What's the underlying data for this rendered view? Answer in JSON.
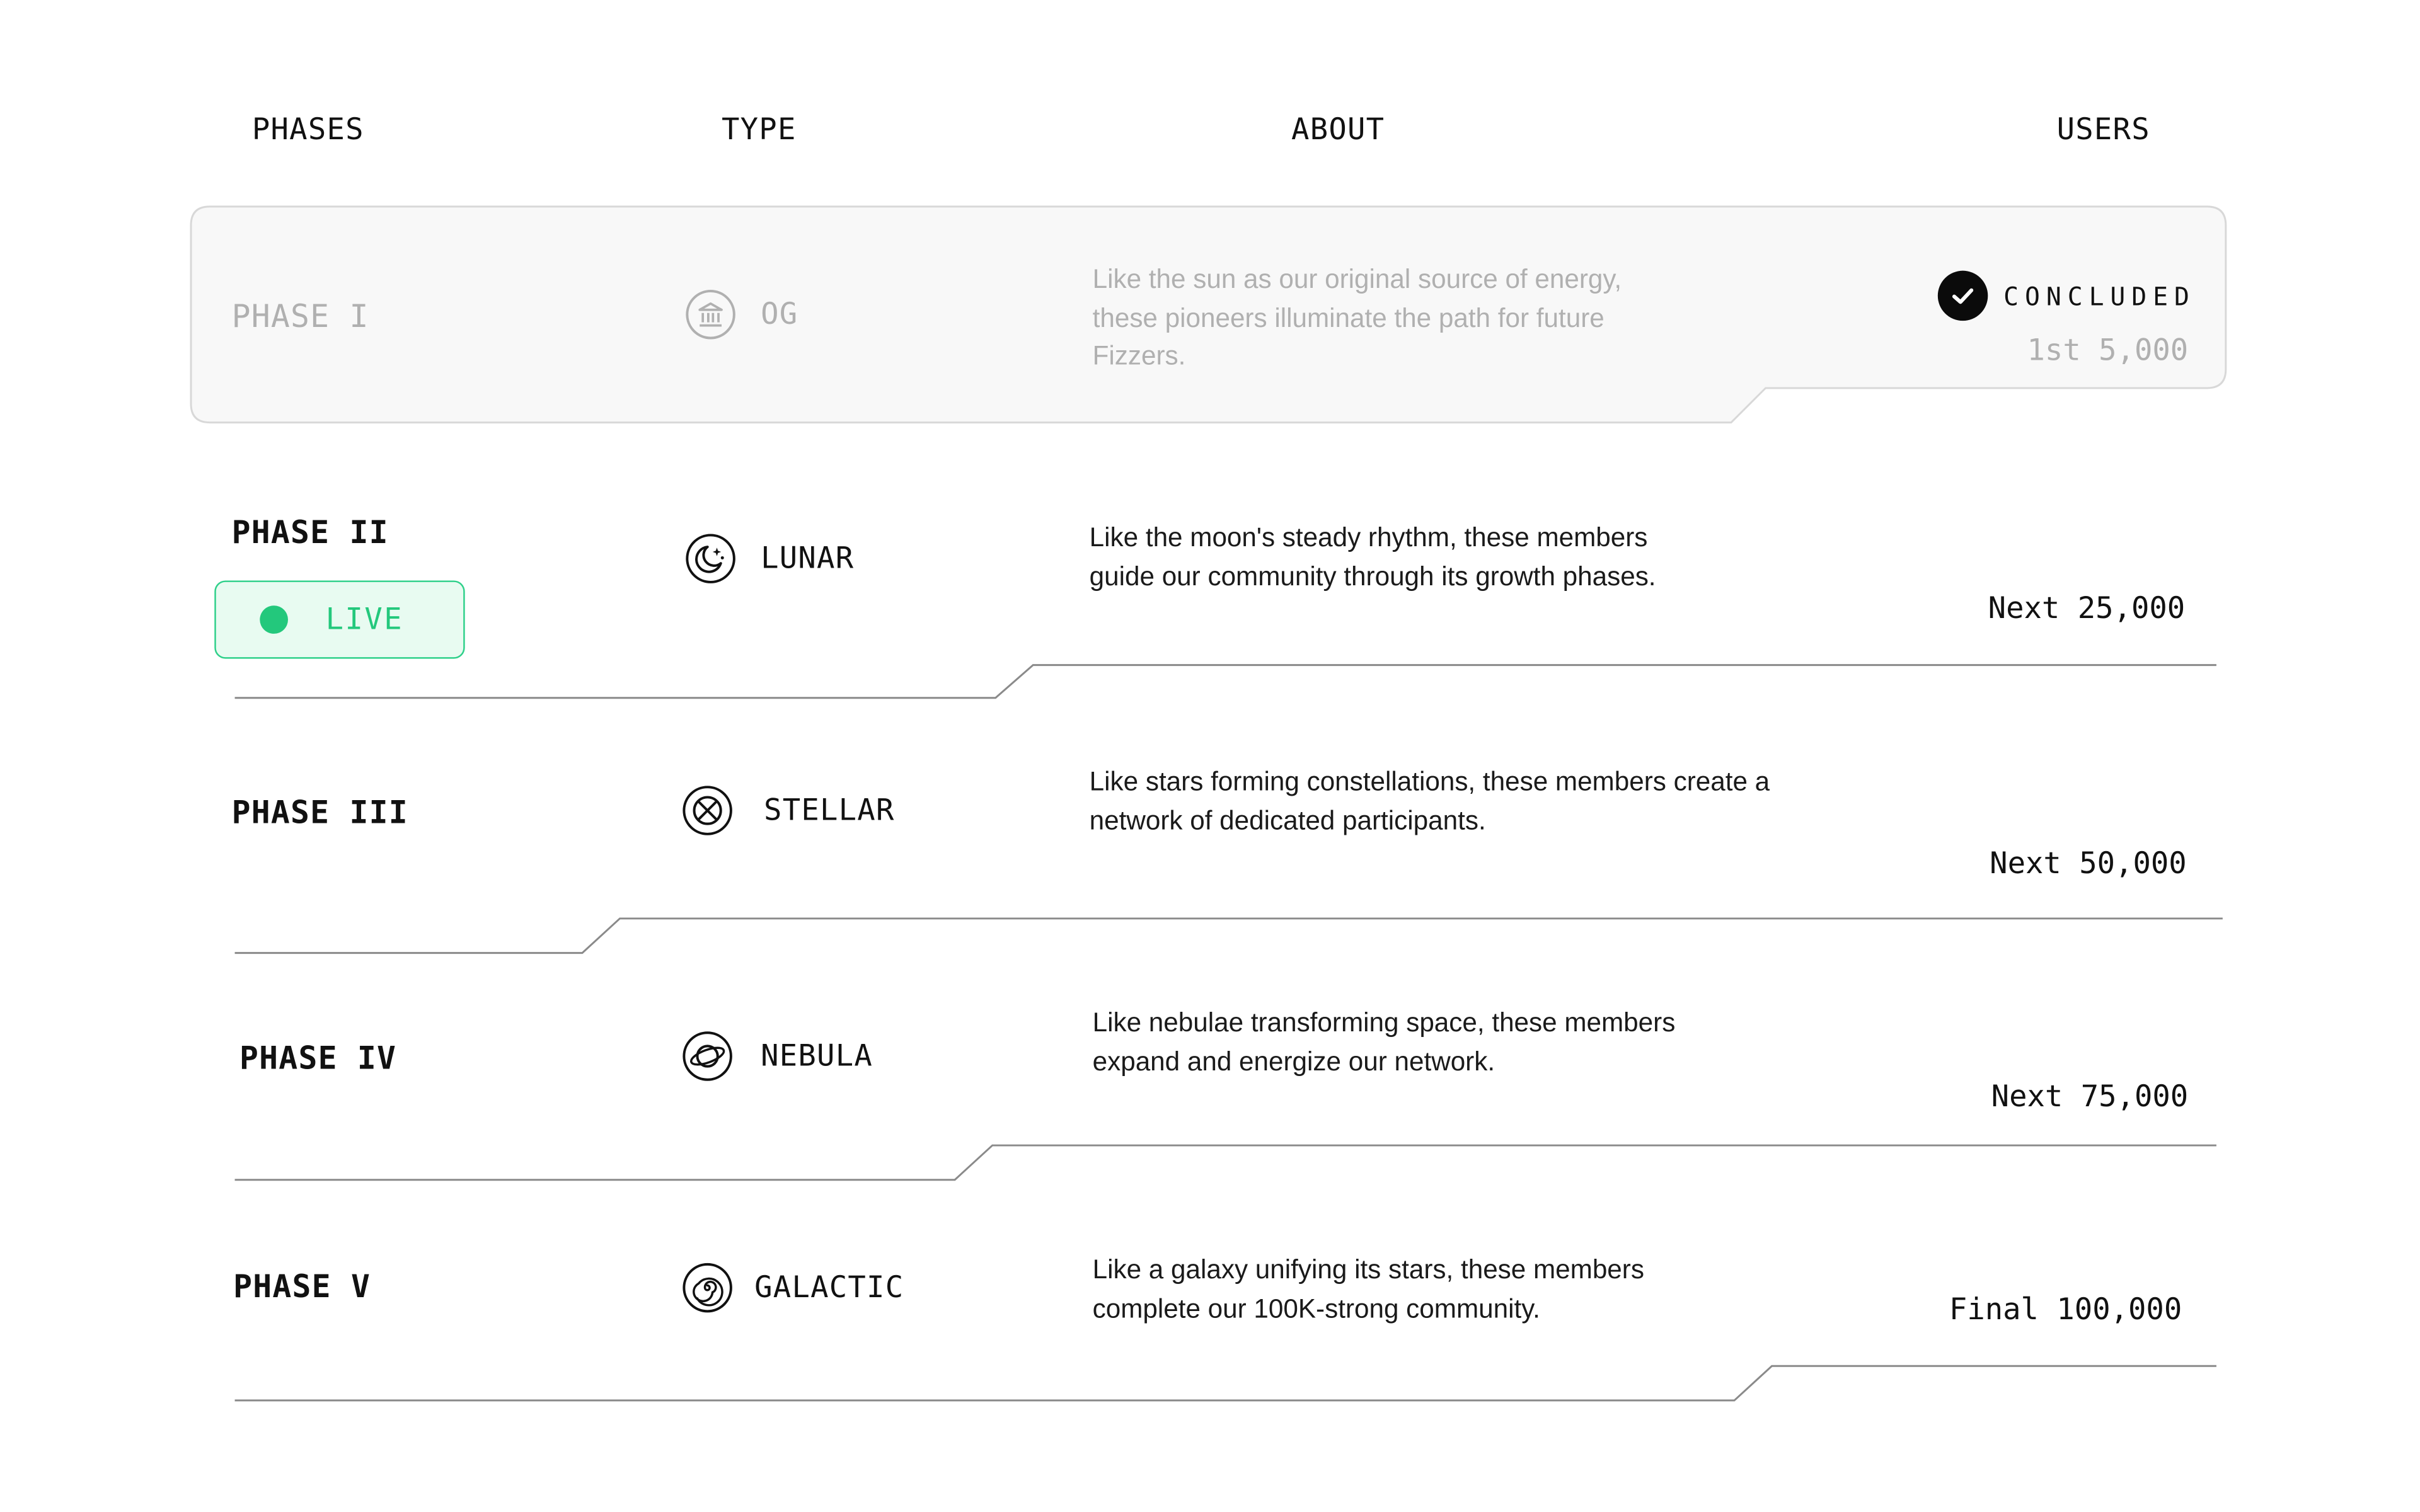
{
  "header": {
    "phases": "PHASES",
    "type": "TYPE",
    "about": "ABOUT",
    "users": "USERS"
  },
  "phases": [
    {
      "name": "PHASE I",
      "type": "OG",
      "icon": "bank-icon",
      "about": "Like the sun as our original source of energy, these pioneers illuminate the path for future Fizzers.",
      "status": "CONCLUDED",
      "users": "1st 5,000"
    },
    {
      "name": "PHASE II",
      "type": "LUNAR",
      "icon": "moon-stars-icon",
      "about": "Like the moon's steady rhythm, these members guide our community through its growth phases.",
      "status": "LIVE",
      "users": "Next 25,000"
    },
    {
      "name": "PHASE III",
      "type": "STELLAR",
      "icon": "star-orbit-icon",
      "about": "Like stars forming constellations, these members create a network of dedicated participants.",
      "users": "Next 50,000"
    },
    {
      "name": "PHASE IV",
      "type": "NEBULA",
      "icon": "planet-ring-icon",
      "about": "Like nebulae transforming space, these members expand and energize our network.",
      "users": "Next 75,000"
    },
    {
      "name": "PHASE V",
      "type": "GALACTIC",
      "icon": "spiral-galaxy-icon",
      "about": "Like a galaxy unifying its stars, these members complete our 100K-strong community.",
      "users": "Final 100,000"
    }
  ],
  "colors": {
    "live_accent": "#23c87c",
    "live_bg": "#e8fbf1",
    "muted_text": "#b0b0b0",
    "concluded_bg": "#f8f8f8",
    "divider": "#8a8a8a"
  }
}
